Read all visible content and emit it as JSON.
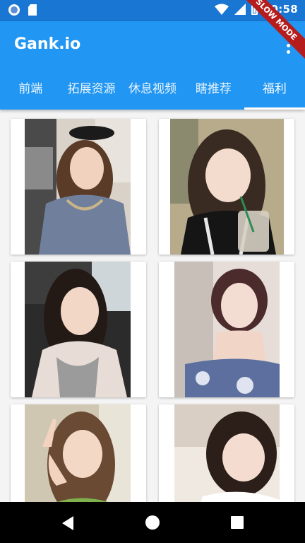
{
  "status_bar": {
    "time": "10:58",
    "icons": [
      "sync-circle-icon",
      "sd-card-icon",
      "wifi-icon",
      "signal-icon",
      "battery-icon"
    ]
  },
  "debug_banner": "SLOW MODE",
  "app_bar": {
    "title": "Gank.io",
    "menu_icon": "more-vert-icon"
  },
  "tabs": [
    {
      "label": "前端",
      "active": false
    },
    {
      "label": "拓展资源",
      "active": false
    },
    {
      "label": "休息视频",
      "active": false
    },
    {
      "label": "瞎推荐",
      "active": false
    },
    {
      "label": "福利",
      "active": true
    }
  ],
  "photos": [
    {
      "subject": "girl-selfie-gray-shirt"
    },
    {
      "subject": "girl-with-drink"
    },
    {
      "subject": "girl-in-car"
    },
    {
      "subject": "girl-short-hair"
    },
    {
      "subject": "girl-peace-sign"
    },
    {
      "subject": "girl-lying-down"
    }
  ],
  "colors": {
    "status_bar": "#1976d2",
    "app_bar": "#2196f3",
    "background": "#f4f4f4",
    "debug_banner": "#b71c1c"
  },
  "nav_bar": {
    "icons": [
      "back-icon",
      "home-icon",
      "recents-icon"
    ]
  }
}
